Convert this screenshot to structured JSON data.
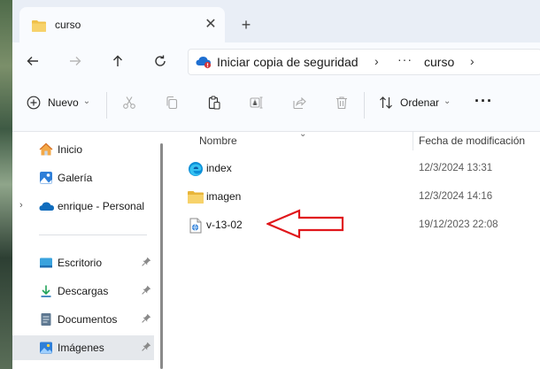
{
  "tab": {
    "title": "curso",
    "close": "✕",
    "new_tab": "+"
  },
  "nav": {
    "back_icon": "arrow-left-icon",
    "forward_icon": "arrow-right-icon",
    "up_icon": "arrow-up-icon",
    "refresh_icon": "refresh-icon"
  },
  "address": {
    "backup_text": "Iniciar copia de seguridad",
    "sep": "›",
    "overflow": "···",
    "folder": "curso"
  },
  "toolbar": {
    "new_label": "Nuevo",
    "new_caret": "⌄",
    "sort_label": "Ordenar",
    "sort_caret": "⌄",
    "more": "···"
  },
  "sidebar": {
    "items": [
      {
        "label": "Inicio",
        "icon": "home-icon"
      },
      {
        "label": "Galería",
        "icon": "gallery-icon"
      },
      {
        "label": "enrique - Personal",
        "icon": "onedrive-icon"
      },
      {
        "label": "Escritorio",
        "icon": "desktop-icon"
      },
      {
        "label": "Descargas",
        "icon": "download-icon"
      },
      {
        "label": "Documentos",
        "icon": "documents-icon"
      },
      {
        "label": "Imágenes",
        "icon": "pictures-icon"
      }
    ],
    "expand": "›",
    "pin": "📌"
  },
  "list": {
    "columns": {
      "name": "Nombre",
      "date": "Fecha de modificación",
      "sort_caret": "⌄"
    },
    "rows": [
      {
        "name": "index",
        "date": "12/3/2024 13:31",
        "icon": "edge-html-icon"
      },
      {
        "name": "imagen",
        "date": "12/3/2024 14:16",
        "icon": "folder-icon"
      },
      {
        "name": "v-13-02",
        "date": "19/12/2023 22:08",
        "icon": "web-document-icon"
      }
    ]
  },
  "colors": {
    "accent": "#0067c0",
    "folder": "#f0c14b",
    "arrow": "#e0161b"
  }
}
